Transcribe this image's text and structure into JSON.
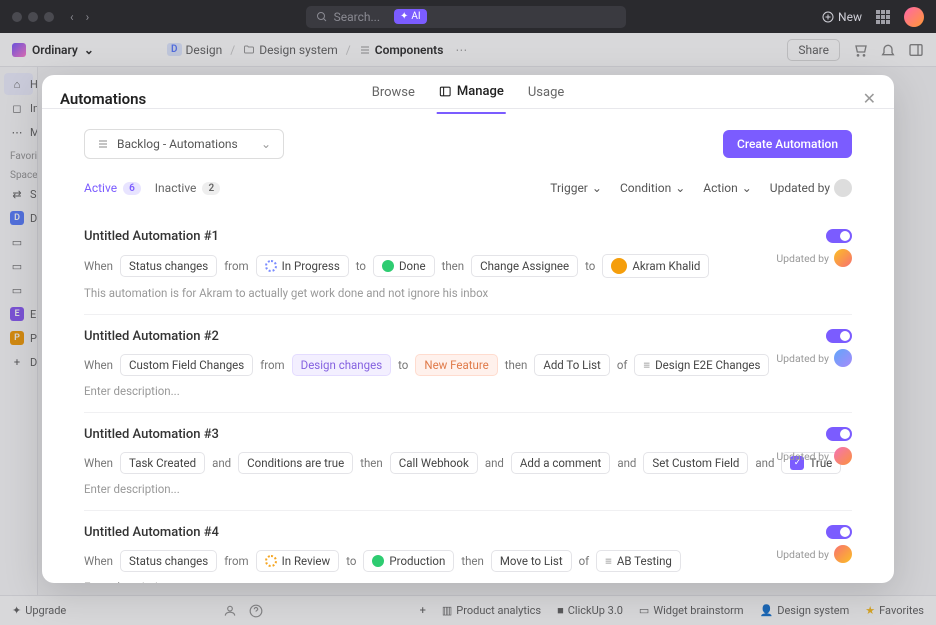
{
  "topbar": {
    "search_placeholder": "Search...",
    "ai_label": "AI",
    "new_label": "New"
  },
  "workspace": {
    "name": "Ordinary"
  },
  "breadcrumb": {
    "items": [
      {
        "chip": "D",
        "label": "Design"
      },
      {
        "label": "Design system"
      },
      {
        "label": "Components"
      }
    ],
    "share_label": "Share"
  },
  "sidebar": {
    "items_top": [
      "Home",
      "Inbox",
      "More"
    ],
    "favorites_label": "Favorites",
    "spaces_label": "Spaces",
    "spaces": [
      {
        "chip": "",
        "label": "Shared"
      },
      {
        "chip": "D",
        "label": "Design",
        "color": "#5b7fff"
      },
      {
        "chip": "E",
        "label": "Engineering",
        "color": "#8b5cf6"
      },
      {
        "chip": "P",
        "label": "Product",
        "color": "#f59e0b"
      },
      {
        "chip": "+",
        "label": "Discover"
      }
    ]
  },
  "bottombar": {
    "upgrade_label": "Upgrade",
    "items": [
      "Product analytics",
      "ClickUp 3.0",
      "Widget brainstorm",
      "Design system",
      "Favorites"
    ]
  },
  "modal": {
    "title": "Automations",
    "tabs": [
      "Browse",
      "Manage",
      "Usage"
    ],
    "active_tab": "Manage",
    "selector_label": "Backlog -  Automations",
    "create_label": "Create Automation",
    "filters": {
      "active_label": "Active",
      "active_count": "6",
      "inactive_label": "Inactive",
      "inactive_count": "2",
      "dropdowns": [
        "Trigger",
        "Condition",
        "Action",
        "Updated by"
      ]
    },
    "automations": [
      {
        "title": "Untitled Automation #1",
        "rule": [
          {
            "t": "text",
            "v": "When"
          },
          {
            "t": "chip",
            "v": "Status changes"
          },
          {
            "t": "text",
            "v": "from"
          },
          {
            "t": "chip",
            "v": "In Progress",
            "icon": "progress"
          },
          {
            "t": "text",
            "v": "to"
          },
          {
            "t": "chip",
            "v": "Done",
            "icon": "done"
          },
          {
            "t": "text",
            "v": "then"
          },
          {
            "t": "chip",
            "v": "Change Assignee"
          },
          {
            "t": "text",
            "v": "to"
          },
          {
            "t": "chip",
            "v": "Akram Khalid",
            "icon": "avatar",
            "avatar": "#f59e0b"
          }
        ],
        "desc": "This automation is for Akram to actually get work done and not ignore his inbox",
        "updated_by_label": "Updated by",
        "avatar": "linear-gradient(135deg,#fbbf24,#f87171)"
      },
      {
        "title": "Untitled Automation #2",
        "rule": [
          {
            "t": "text",
            "v": "When"
          },
          {
            "t": "chip",
            "v": "Custom Field Changes"
          },
          {
            "t": "text",
            "v": "from"
          },
          {
            "t": "chip",
            "v": "Design changes",
            "style": "purple"
          },
          {
            "t": "text",
            "v": "to"
          },
          {
            "t": "chip",
            "v": "New Feature",
            "style": "orange"
          },
          {
            "t": "text",
            "v": "then"
          },
          {
            "t": "chip",
            "v": "Add To List"
          },
          {
            "t": "text",
            "v": "of"
          },
          {
            "t": "chip",
            "v": "Design E2E Changes",
            "icon": "list"
          }
        ],
        "desc": "Enter description...",
        "updated_by_label": "Updated by",
        "avatar": "linear-gradient(135deg,#60a5fa,#a78bfa)"
      },
      {
        "title": "Untitled Automation #3",
        "rule": [
          {
            "t": "text",
            "v": "When"
          },
          {
            "t": "chip",
            "v": "Task Created"
          },
          {
            "t": "text",
            "v": "and"
          },
          {
            "t": "chip",
            "v": "Conditions are true"
          },
          {
            "t": "text",
            "v": "then"
          },
          {
            "t": "chip",
            "v": "Call Webhook"
          },
          {
            "t": "text",
            "v": "and"
          },
          {
            "t": "chip",
            "v": "Add a comment"
          },
          {
            "t": "text",
            "v": "and"
          },
          {
            "t": "chip",
            "v": "Set Custom Field"
          },
          {
            "t": "text",
            "v": "and"
          },
          {
            "t": "chip",
            "v": "True",
            "icon": "check"
          }
        ],
        "desc": "Enter description...",
        "updated_by_label": "Updated by",
        "avatar": "linear-gradient(135deg,#f472b6,#fb923c)"
      },
      {
        "title": "Untitled Automation #4",
        "rule": [
          {
            "t": "text",
            "v": "When"
          },
          {
            "t": "chip",
            "v": "Status changes"
          },
          {
            "t": "text",
            "v": "from"
          },
          {
            "t": "chip",
            "v": "In Review",
            "icon": "review"
          },
          {
            "t": "text",
            "v": "to"
          },
          {
            "t": "chip",
            "v": "Production",
            "icon": "prod"
          },
          {
            "t": "text",
            "v": "then"
          },
          {
            "t": "chip",
            "v": "Move to List"
          },
          {
            "t": "text",
            "v": "of"
          },
          {
            "t": "chip",
            "v": "AB Testing",
            "icon": "list"
          }
        ],
        "desc": "Enter description...",
        "updated_by_label": "Updated by",
        "avatar": "linear-gradient(135deg,#f87171,#fbbf24)"
      }
    ]
  }
}
